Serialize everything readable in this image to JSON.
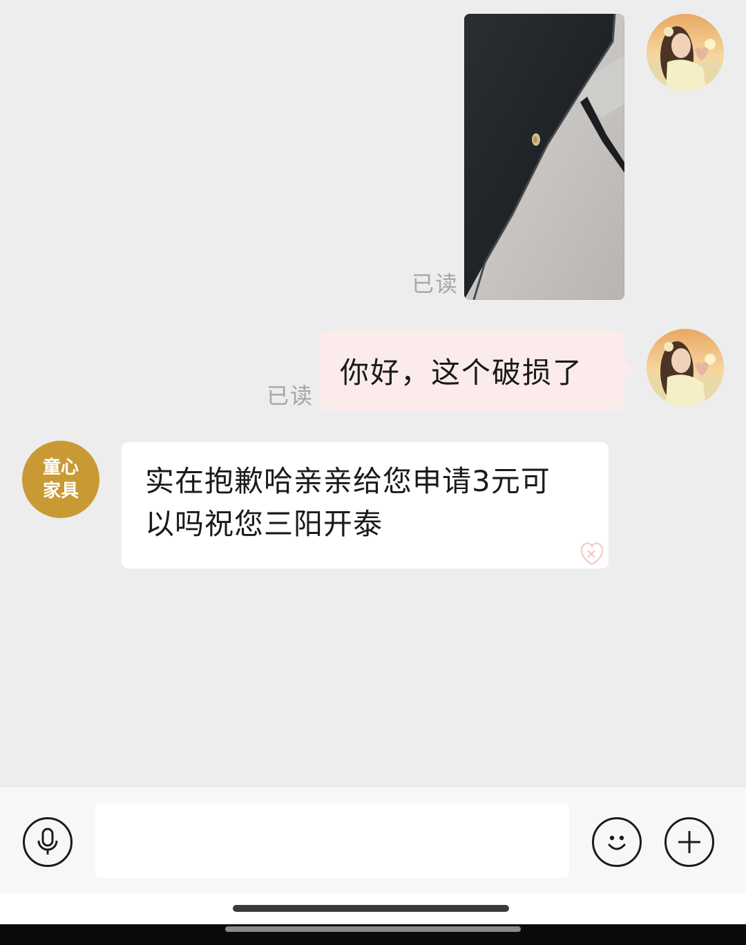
{
  "messages": [
    {
      "sender": "user",
      "kind": "image",
      "status": "已读",
      "image_desc": "photo of a black furniture panel edge with a chipped corner"
    },
    {
      "sender": "user",
      "kind": "text",
      "status": "已读",
      "text": "你好，这个破损了"
    },
    {
      "sender": "shop",
      "kind": "text",
      "text_line1": "实在抱歉哈亲亲给您申请3元可",
      "text_line2": "以吗祝您三阳开泰"
    }
  ],
  "shop_avatar": {
    "line1": "童心",
    "line2": "家具"
  },
  "input_bar": {
    "value": "",
    "icons": [
      "microphone-icon",
      "emoji-icon",
      "plus-icon"
    ]
  },
  "colors": {
    "background": "#ededed",
    "sent_bubble": "#fbeceb",
    "received_bubble": "#ffffff",
    "shop_avatar": "#c99a33",
    "read_receipt": "#a6a6a6"
  }
}
